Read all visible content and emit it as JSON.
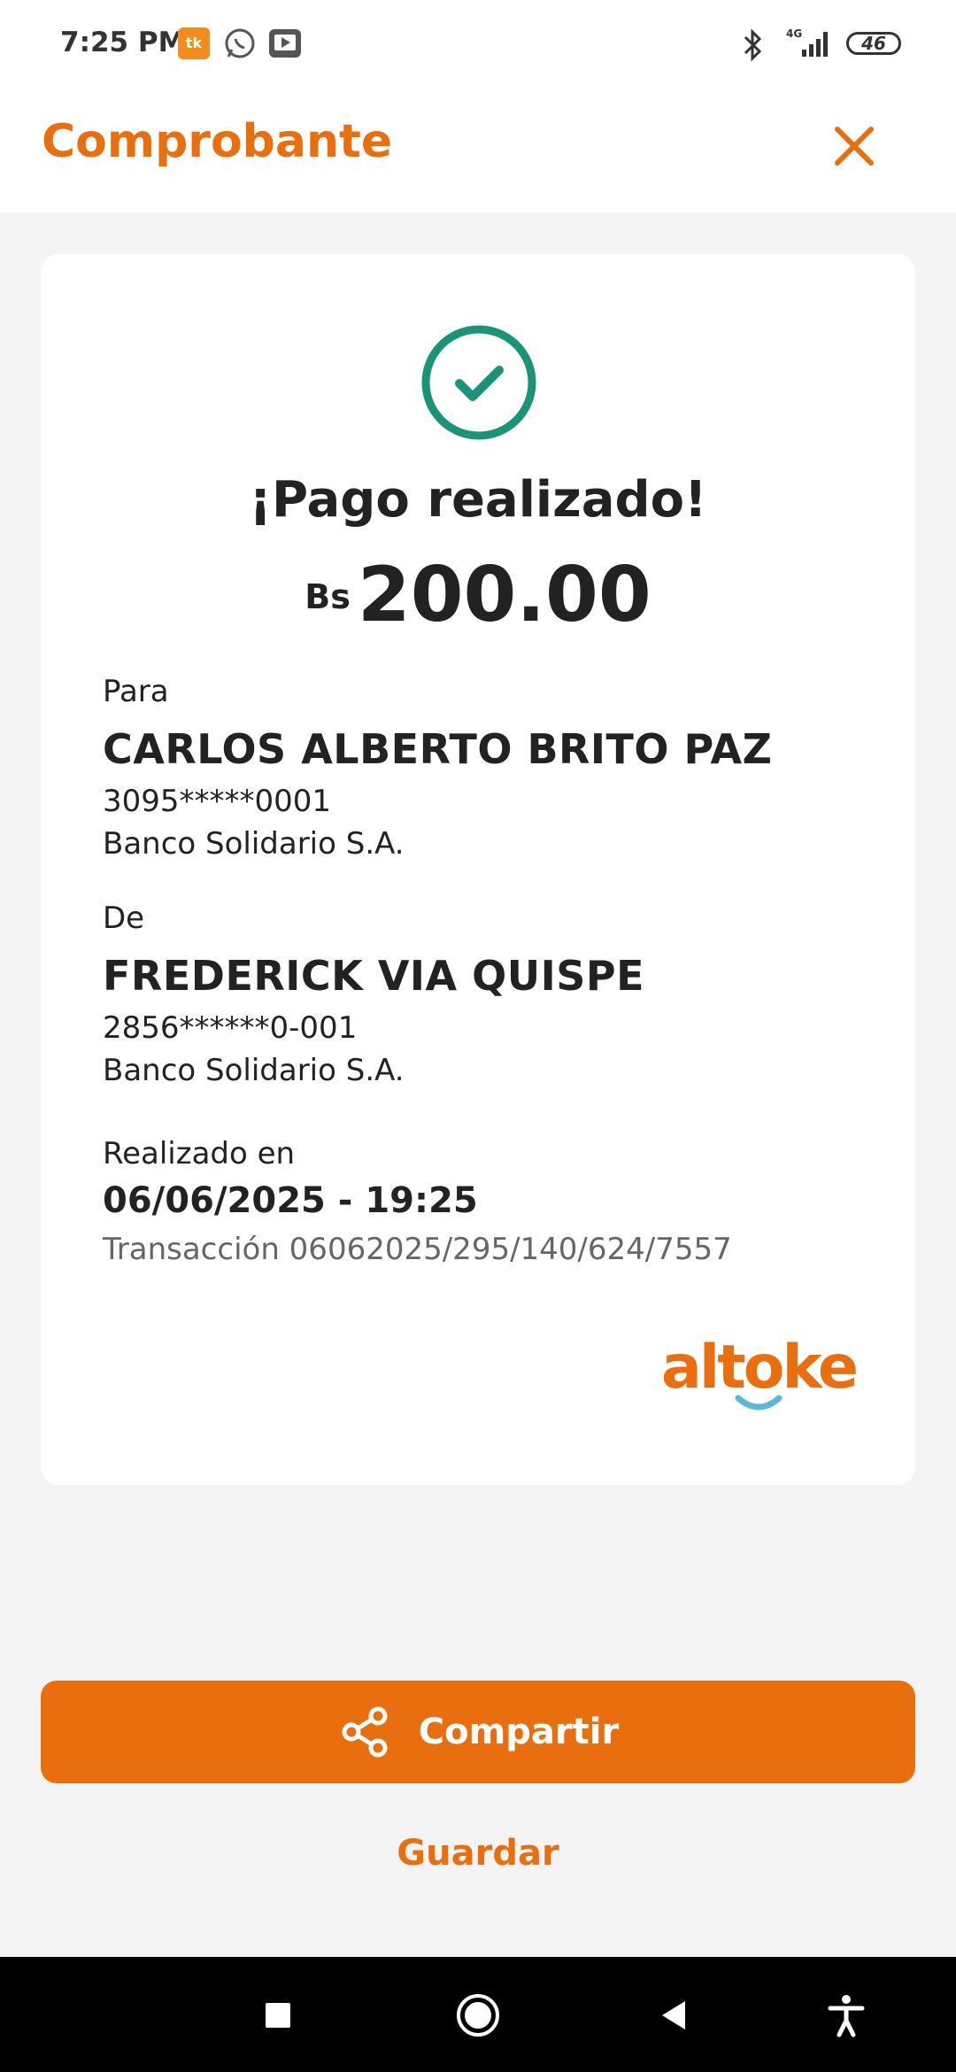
{
  "status_bar": {
    "time": "7:25 PM",
    "battery": "46",
    "network": "4G",
    "icons": [
      "tk-app-icon",
      "whatsapp-icon",
      "youtube-icon",
      "bluetooth-icon",
      "signal-icon",
      "battery-icon"
    ]
  },
  "header": {
    "title": "Comprobante",
    "close_icon": "close-icon"
  },
  "receipt": {
    "status_icon": "check-circle-icon",
    "title": "¡Pago realizado!",
    "currency": "Bs",
    "amount": "200.00",
    "to": {
      "label": "Para",
      "name": "CARLOS ALBERTO BRITO PAZ",
      "account": "3095*****0001",
      "bank": "Banco Solidario S.A."
    },
    "from": {
      "label": "De",
      "name": "FREDERICK VIA QUISPE",
      "account": "2856******0-001",
      "bank": "Banco Solidario S.A."
    },
    "done_label": "Realizado en",
    "datetime": "06/06/2025 - 19:25",
    "transaction": "Transacción 06062025/295/140/624/7557",
    "brand": "altoke"
  },
  "actions": {
    "share_label": "Compartir",
    "share_icon": "share-icon",
    "save_label": "Guardar"
  },
  "colors": {
    "accent": "#E96F0E",
    "success": "#1A9477",
    "brand_smile": "#5BB8D9"
  },
  "nav": {
    "icons": [
      "recents-square-icon",
      "home-circle-icon",
      "back-triangle-icon",
      "accessibility-icon"
    ]
  }
}
